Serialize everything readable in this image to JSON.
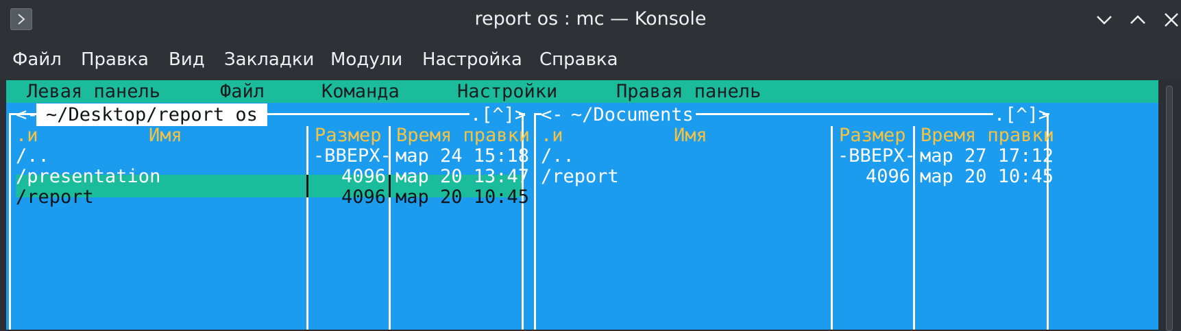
{
  "window": {
    "title": "report os : mc — Konsole",
    "menu_button_icon": "chevron-right-icon",
    "controls": [
      "minimize-chevron-down-icon",
      "maximize-chevron-up-icon",
      "close-x-icon"
    ]
  },
  "konsole_menu": [
    "Файл",
    "Правка",
    "Вид",
    "Закладки",
    "Модули",
    "Настройка",
    "Справка"
  ],
  "mc_menu": [
    "Левая панель",
    "Файл",
    "Команда",
    "Настройки",
    "Правая панель"
  ],
  "left_panel": {
    "prefix": "<-",
    "path": "~/Desktop/report os",
    "corner": ".[^]>",
    "headers": {
      "sort": ".и",
      "name": "Имя",
      "size": "Размер",
      "mtime": "Время правки"
    },
    "rows": [
      {
        "name": "/..",
        "size": "-ВВЕРХ-",
        "mtime": "мар 24 15:18"
      },
      {
        "name": "/presentation",
        "size": "4096",
        "mtime": "мар 20 13:47"
      },
      {
        "name": "/report",
        "size": "4096",
        "mtime": "мар 20 10:45"
      }
    ],
    "selected_index": 2
  },
  "right_panel": {
    "prefix": "<-",
    "path": "~/Documents",
    "corner": ".[^]>",
    "headers": {
      "sort": ".и",
      "name": "Имя",
      "size": "Размер",
      "mtime": "Время правки"
    },
    "rows": [
      {
        "name": "/..",
        "size": "-ВВЕРХ-",
        "mtime": "мар 27 17:12"
      },
      {
        "name": "/report",
        "size": "4096",
        "mtime": "мар 20 10:45"
      }
    ]
  },
  "colors": {
    "terminal_bg": "#1b9cef",
    "accent_teal": "#1abc9c",
    "header_yellow": "#f5c242",
    "window_bg": "#2e3236"
  }
}
